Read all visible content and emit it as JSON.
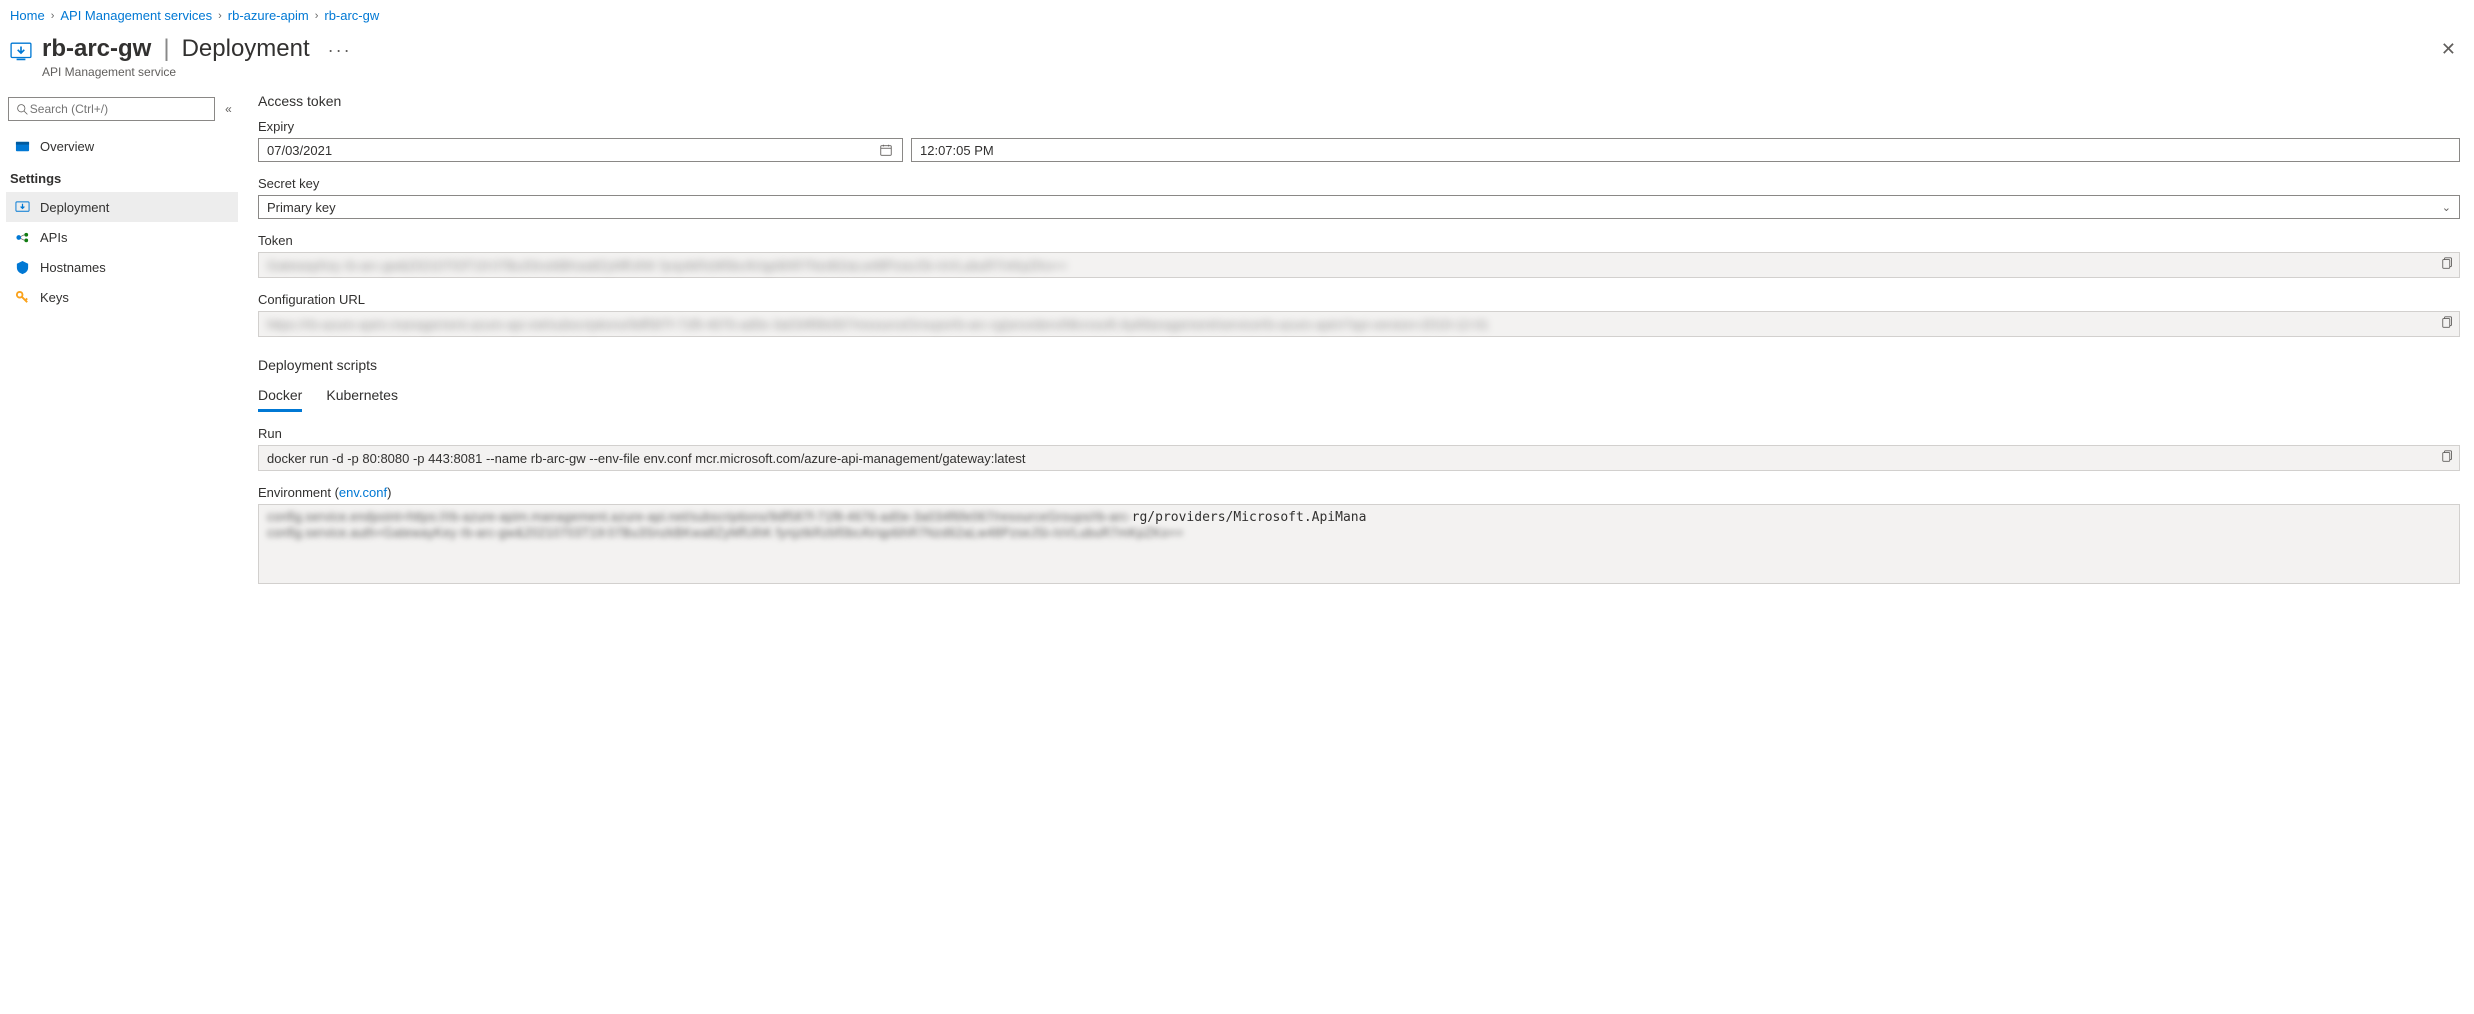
{
  "breadcrumb": {
    "items": [
      "Home",
      "API Management services",
      "rb-azure-apim",
      "rb-arc-gw"
    ]
  },
  "header": {
    "resource_name": "rb-arc-gw",
    "page_name": "Deployment",
    "subtitle": "API Management service"
  },
  "sidebar": {
    "search_placeholder": "Search (Ctrl+/)",
    "overview_label": "Overview",
    "settings_section": "Settings",
    "items": {
      "deployment": "Deployment",
      "apis": "APIs",
      "hostnames": "Hostnames",
      "keys": "Keys"
    }
  },
  "main": {
    "access_token_title": "Access token",
    "expiry_label": "Expiry",
    "expiry_date": "07/03/2021",
    "expiry_time": "12:07:05 PM",
    "secret_key_label": "Secret key",
    "secret_key_value": "Primary key",
    "token_label": "Token",
    "token_value_blurred": "GatewayKey rb-arc-gw&20210703T19:07Bu3SnzkBKwa8ZyMfUihK fynjztkRzbf0bcAVqp6ihR7Nzd62aLw48PzseJSi-/oVLubuR7mKpZKo==",
    "config_url_label": "Configuration URL",
    "config_url_value_blurred": "https://rb-azure-apim.management.azure-api.net/subscriptions/9df587f-71f8-4676-ad0e-3a034f6fe067/resourceGroups/rb-arc-rg/providers/Microsoft.ApiManagement/service/rb-azure-apim?api-version=2019-12-01",
    "deployment_scripts_title": "Deployment scripts",
    "tabs": {
      "docker": "Docker",
      "kubernetes": "Kubernetes"
    },
    "run_label": "Run",
    "run_value": "docker run -d -p 80:8080 -p 443:8081 --name rb-arc-gw --env-file env.conf mcr.microsoft.com/azure-api-management/gateway:latest",
    "env_label_pre": "Environment (",
    "env_link": "env.conf",
    "env_label_post": ")",
    "env_blurred_line1": "config.service.endpoint=https://rb-azure-apim.management.azure-api.net/subscriptions/9df587f-71f8-4676-ad0e-3a034f6fe067/resourceGroups/rb-arc-",
    "env_visible_tail": "rg/providers/Microsoft.ApiMana",
    "env_blurred_line2": "config.service.auth=GatewayKey rb-arc-gw&20210703T19:07Bu3SnzkBKwa8ZyMfUihK fynjztkRzbf0bcAVqp6ihR7Nzd62aLw48PzseJSi-/oVLubuR7mKpZKo=="
  }
}
